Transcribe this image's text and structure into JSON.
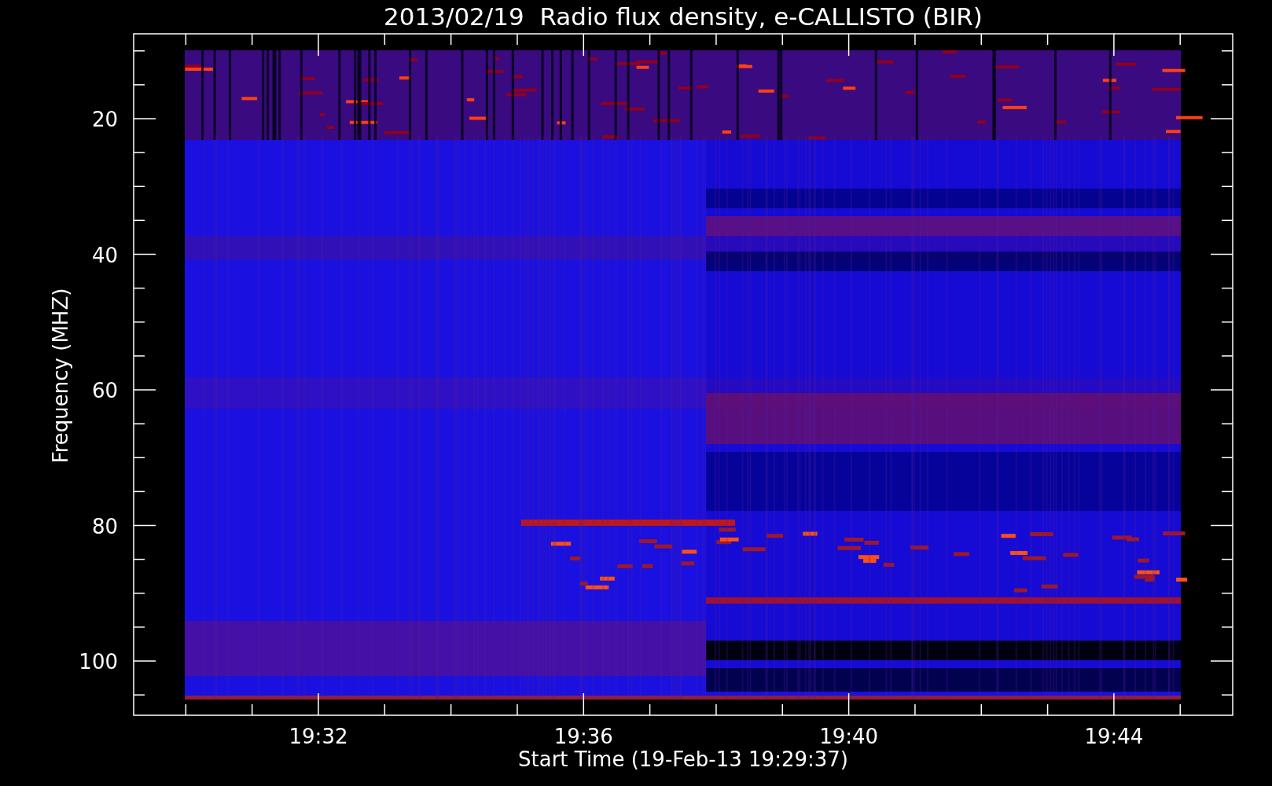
{
  "title": "2013/02/19  Radio flux density, e-CALLISTO (BIR)",
  "y_axis": {
    "label": "Frequency (MHZ)",
    "ticks": [
      "20",
      "40",
      "60",
      "80",
      "100"
    ]
  },
  "x_axis": {
    "label": "Start Time (19-Feb-13 19:29:37)",
    "ticks": [
      "19:32",
      "19:36",
      "19:40",
      "19:44"
    ]
  }
}
